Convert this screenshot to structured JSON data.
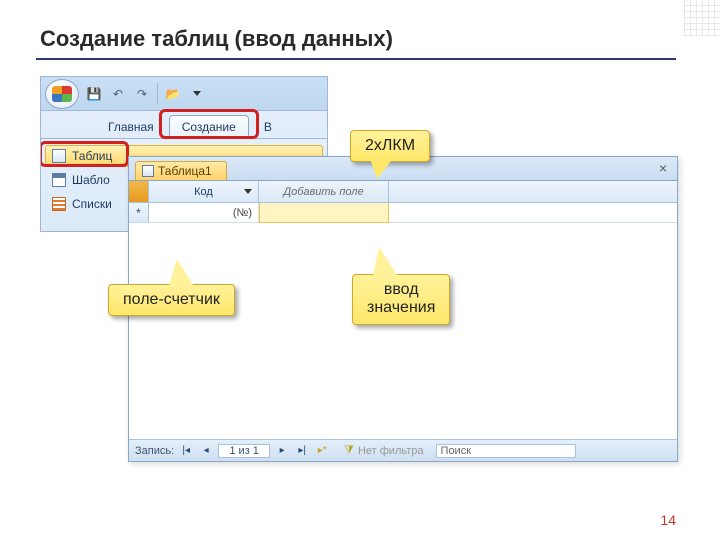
{
  "slide": {
    "title": "Создание таблиц (ввод данных)",
    "page_number": "14"
  },
  "ribbon": {
    "tabs": {
      "home": "Главная",
      "create": "Создание",
      "next_initial": "В"
    },
    "nav": {
      "table": "Таблиц",
      "templates": "Шабло",
      "lists": "Списки"
    }
  },
  "datasheet": {
    "tab_label": "Таблица1",
    "col_id": "Код",
    "col_add": "Добавить поле",
    "new_row_value": "(№)",
    "status": {
      "record_label": "Запись:",
      "record_pos": "1 из 1",
      "filter": "Нет фильтра",
      "search": "Поиск"
    }
  },
  "callouts": {
    "double_click": "2хЛКМ",
    "counter": "поле-счетчик",
    "enter_value_l1": "ввод",
    "enter_value_l2": "значения"
  }
}
